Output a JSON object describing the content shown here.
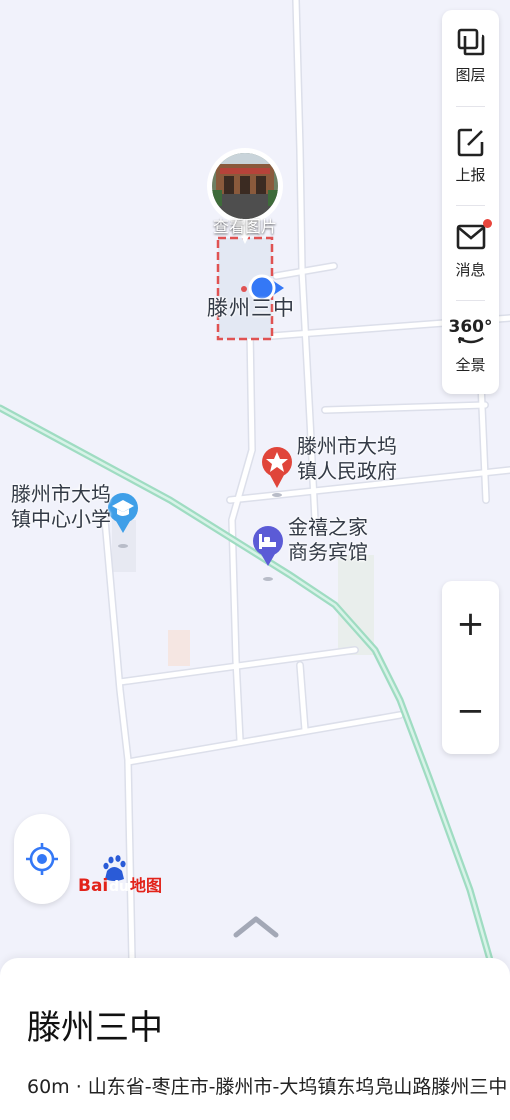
{
  "map": {
    "selected_place_label": "滕州三中",
    "photo_caption": "查看图片",
    "pois": [
      {
        "name": "滕州市大坞\n镇人民政府",
        "icon": "star-icon",
        "color": "#e0453a"
      },
      {
        "name": "滕州市大坞\n镇中心小学",
        "icon": "school-icon",
        "color": "#3f9fe8"
      },
      {
        "name": "金禧之家\n商务宾馆",
        "icon": "hotel-icon",
        "color": "#5b5bd6"
      }
    ]
  },
  "side_panel": {
    "items": [
      {
        "label": "图层",
        "icon": "layers-icon"
      },
      {
        "label": "上报",
        "icon": "report-icon"
      },
      {
        "label": "消息",
        "icon": "message-icon",
        "badge": true
      },
      {
        "label": "全景",
        "icon": "panorama-360-icon",
        "icon_text": "360°"
      }
    ]
  },
  "zoom": {
    "in": "+",
    "out": "−"
  },
  "logo": {
    "text_bai": "Bai",
    "text_du": "du",
    "text_map": "地图"
  },
  "sheet": {
    "title": "滕州三中",
    "address": "60m · 山东省-枣庄市-滕州市-大坞镇东坞凫山路滕州三中"
  },
  "colors": {
    "map_bg": "#f1f2fb",
    "road": "#ffffff",
    "railway": "#a8e0c8",
    "accent_blue": "#3478f6",
    "area_red": "#e05252"
  }
}
